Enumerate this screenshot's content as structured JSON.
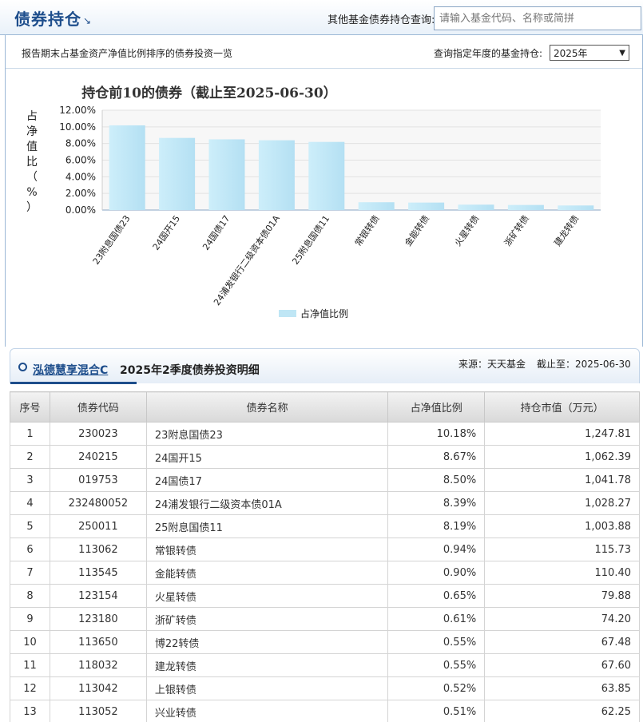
{
  "header": {
    "title": "债券持仓",
    "title_icon": "corner-arrow-icon",
    "query_label": "其他基金债券持仓查询:",
    "query_placeholder": "请输入基金代码、名称或简拼"
  },
  "subbar": {
    "description": "报告期末占基金资产净值比例排序的债券投资一览",
    "year_label": "查询指定年度的基金持仓:",
    "year_value": "2025年"
  },
  "chart_data": {
    "type": "bar",
    "title": "持仓前10的债券（截止至2025-06-30）",
    "ylabel": "占净值比（%）",
    "ylim": [
      0,
      12
    ],
    "yticks": [
      "0.00%",
      "2.00%",
      "4.00%",
      "6.00%",
      "8.00%",
      "10.00%",
      "12.00%"
    ],
    "categories": [
      "23附息国债23",
      "24国开15",
      "24国债17",
      "24浦发银行二级资本债01A",
      "25附息国债11",
      "常银转债",
      "金能转债",
      "火星转债",
      "浙矿转债",
      "建龙转债"
    ],
    "series": [
      {
        "name": "占净值比例",
        "values": [
          10.18,
          8.67,
          8.5,
          8.39,
          8.19,
          0.94,
          0.9,
          0.65,
          0.61,
          0.55
        ]
      }
    ],
    "grid": true,
    "legend_position": "bottom",
    "bar_color": "#bfe6f5"
  },
  "detail": {
    "fund_name": "泓德慧享混合C",
    "period": "2025年2季度债券投资明细",
    "source": "来源：天天基金",
    "deadline": "截止至：2025-06-30"
  },
  "table": {
    "headers": [
      "序号",
      "债券代码",
      "债券名称",
      "占净值比例",
      "持仓市值（万元）"
    ],
    "rows": [
      [
        "1",
        "230023",
        "23附息国债23",
        "10.18%",
        "1,247.81"
      ],
      [
        "2",
        "240215",
        "24国开15",
        "8.67%",
        "1,062.39"
      ],
      [
        "3",
        "019753",
        "24国债17",
        "8.50%",
        "1,041.78"
      ],
      [
        "4",
        "232480052",
        "24浦发银行二级资本债01A",
        "8.39%",
        "1,028.27"
      ],
      [
        "5",
        "250011",
        "25附息国债11",
        "8.19%",
        "1,003.88"
      ],
      [
        "6",
        "113062",
        "常银转债",
        "0.94%",
        "115.73"
      ],
      [
        "7",
        "113545",
        "金能转债",
        "0.90%",
        "110.40"
      ],
      [
        "8",
        "123154",
        "火星转债",
        "0.65%",
        "79.88"
      ],
      [
        "9",
        "123180",
        "浙矿转债",
        "0.61%",
        "74.20"
      ],
      [
        "10",
        "113650",
        "博22转债",
        "0.55%",
        "67.48"
      ],
      [
        "11",
        "118032",
        "建龙转债",
        "0.55%",
        "67.60"
      ],
      [
        "12",
        "113042",
        "上银转债",
        "0.52%",
        "63.85"
      ],
      [
        "13",
        "113052",
        "兴业转债",
        "0.51%",
        "62.25"
      ]
    ]
  }
}
